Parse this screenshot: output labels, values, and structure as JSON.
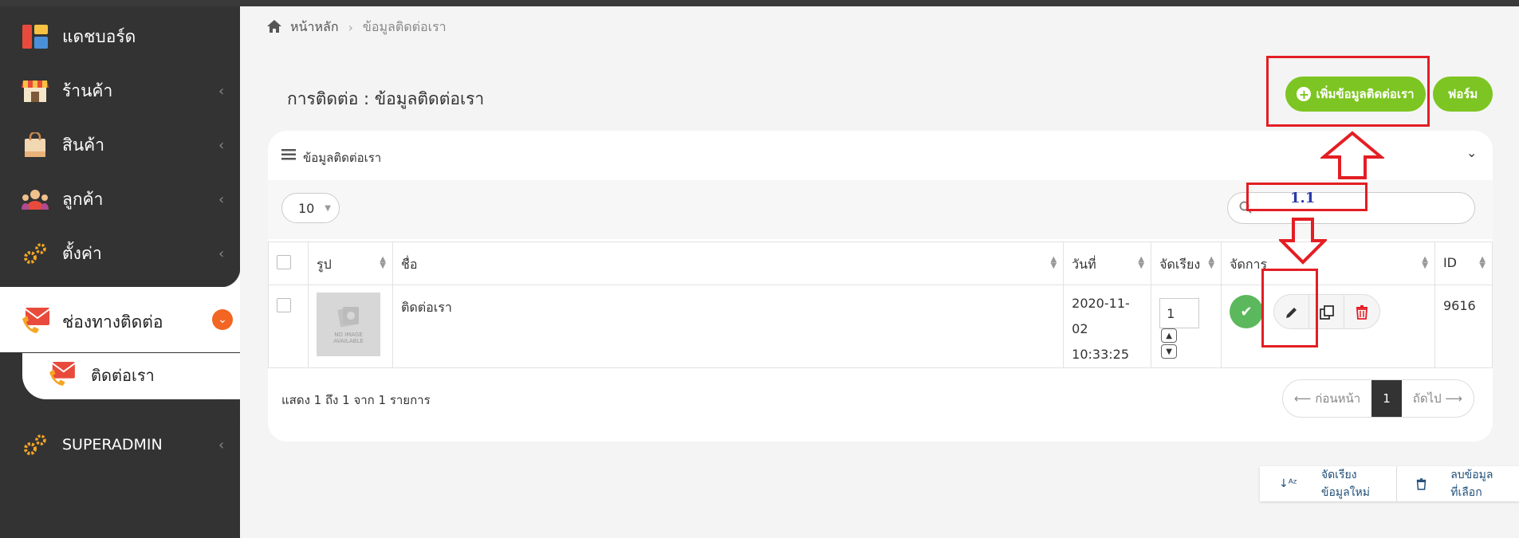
{
  "sidebar": {
    "items": [
      {
        "label": "แดชบอร์ด",
        "icon": "dashboard-icon"
      },
      {
        "label": "ร้านค้า",
        "icon": "store-icon"
      },
      {
        "label": "สินค้า",
        "icon": "shopping-bag-icon"
      },
      {
        "label": "ลูกค้า",
        "icon": "customers-icon"
      },
      {
        "label": "ตั้งค่า",
        "icon": "gears-icon"
      }
    ],
    "active": {
      "label": "ช่องทางติดต่อ",
      "icon": "contact-mail-icon"
    },
    "sub": {
      "label": "ติดต่อเรา",
      "icon": "contact-mail-icon"
    },
    "superadmin": {
      "label": "SUPERADMIN",
      "icon": "gears-icon"
    }
  },
  "breadcrumb": {
    "home": "หน้าหลัก",
    "current": "ข้อมูลติดต่อเรา"
  },
  "page_title": "การติดต่อ : ข้อมูลติดต่อเรา",
  "buttons": {
    "add": "เพิ่มข้อมูลติดต่อเรา",
    "form": "ฟอร์ม"
  },
  "card": {
    "title": "ข้อมูลติดต่อเรา"
  },
  "page_size": "10",
  "table": {
    "headers": [
      "รูป",
      "ชื่อ",
      "วันที่",
      "จัดเรียง",
      "จัดการ",
      "ID"
    ],
    "rows": [
      {
        "name": "ติดต่อเรา",
        "date": "2020-11-02",
        "time": "10:33:25",
        "order": "1",
        "id": "9616",
        "image_placeholder": "NO IMAGE AVAILABLE"
      }
    ]
  },
  "info": "แสดง 1 ถึง 1 จาก 1 รายการ",
  "pager": {
    "prev": "⟵ ก่อนหน้า",
    "page": "1",
    "next": "ถัดไป ⟶"
  },
  "bottom": {
    "reorder": "จัดเรียงข้อมูลใหม่",
    "delete": "ลบข้อมูลที่เลือก"
  },
  "annotation": {
    "label": "1.1",
    "color": "#e31e24"
  },
  "colors": {
    "accent": "#7dc522",
    "sidebar": "#333333",
    "badge": "#f26522"
  }
}
